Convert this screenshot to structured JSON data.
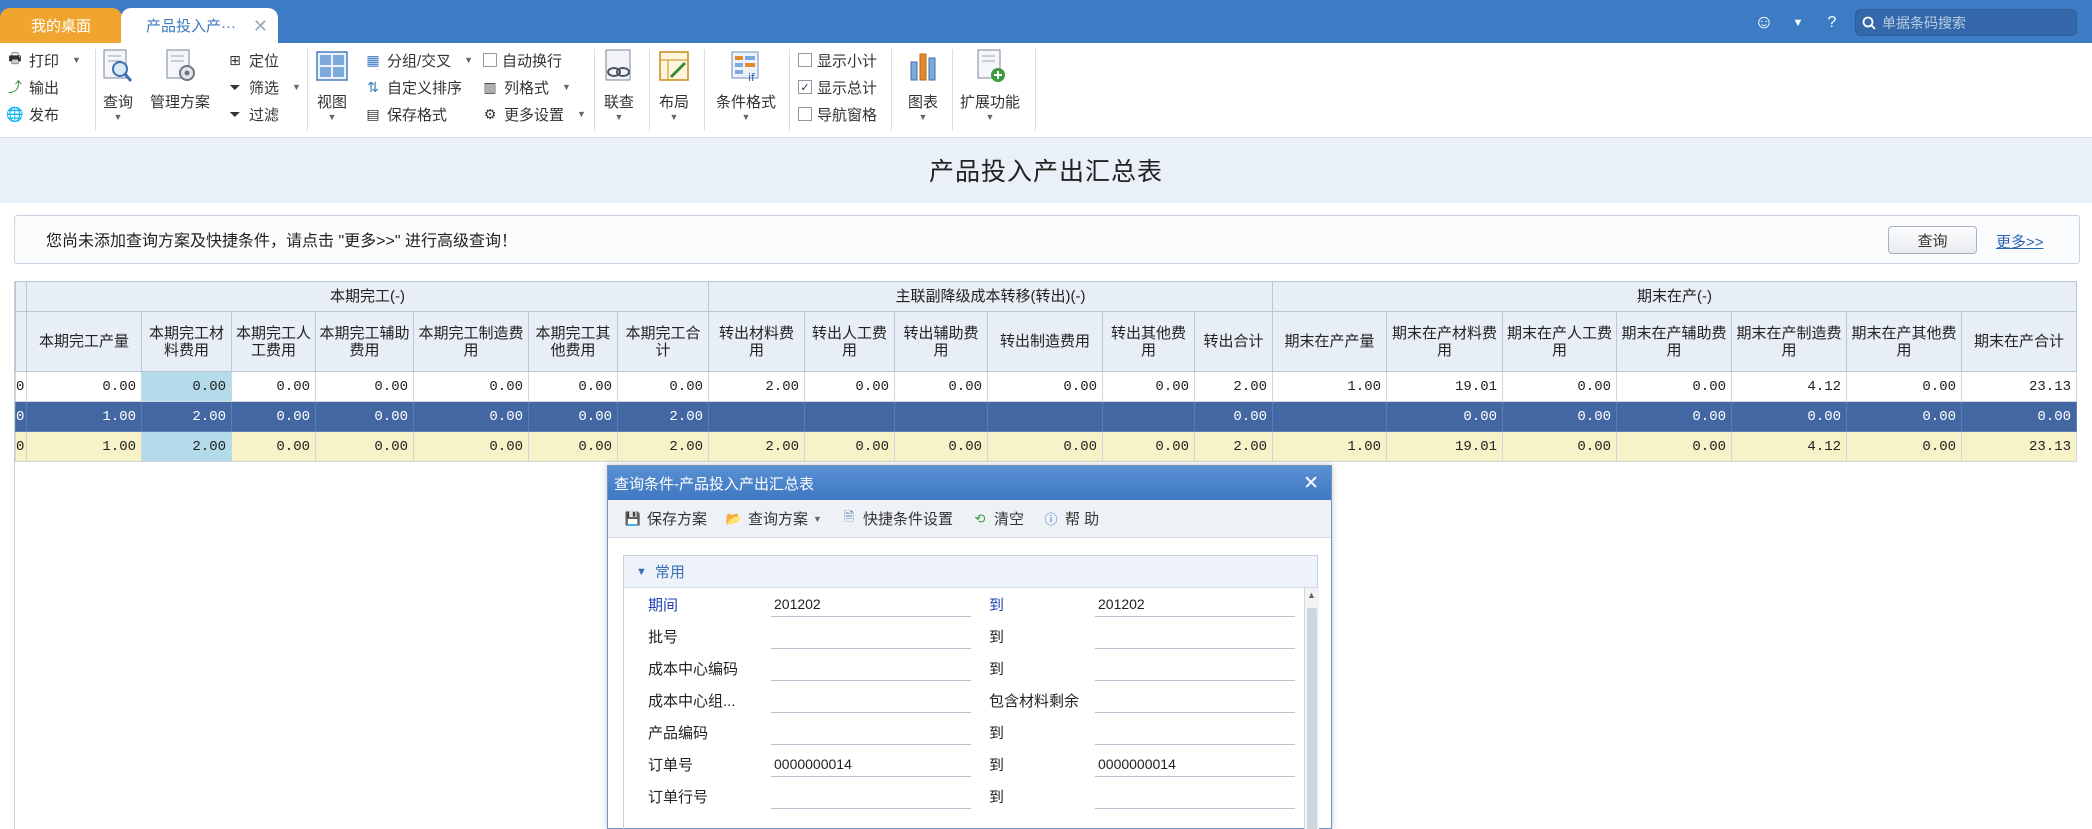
{
  "tabs": {
    "home": "我的桌面",
    "report": "产品投入产···"
  },
  "search": {
    "placeholder": "单据条码搜索"
  },
  "toolbar": {
    "print": "打印",
    "export": "输出",
    "publish": "发布",
    "query": "查询",
    "manage_plan": "管理方案",
    "locate": "定位",
    "filter": "筛选",
    "filter2": "过滤",
    "view": "视图",
    "group_cross": "分组/交叉",
    "custom_sort": "自定义排序",
    "save_format": "保存格式",
    "auto_wrap": "自动换行",
    "column_format": "列格式",
    "more_settings": "更多设置",
    "link_query": "联查",
    "layout": "布局",
    "cond_format": "条件格式",
    "show_subtotal": "显示小计",
    "show_total": "显示总计",
    "nav_pane": "导航窗格",
    "chart": "图表",
    "extend": "扩展功能"
  },
  "page_title": "产品投入产出汇总表",
  "notice": {
    "text": "您尚未添加查询方案及快捷条件，请点击 \"更多>>\" 进行高级查询！",
    "query_button": "查询",
    "more_link": "更多>>"
  },
  "grid": {
    "groups": [
      "本期完工(-)",
      "主联副降级成本转移(转出)(-)",
      "期末在产(-)"
    ],
    "headers": [
      "本期完工产量",
      "本期完工材料费用",
      "本期完工人工费用",
      "本期完工辅助费用",
      "本期完工制造费用",
      "本期完工其他费用",
      "本期完工合计",
      "转出材料费用",
      "转出人工费用",
      "转出辅助费用",
      "转出制造费用",
      "转出其他费用",
      "转出合计",
      "期末在产产量",
      "期末在产材料费用",
      "期末在产人工费用",
      "期末在产辅助费用",
      "期末在产制造费用",
      "期末在产其他费用",
      "期末在产合计"
    ],
    "rows": [
      [
        "0",
        "0.00",
        "0.00",
        "0.00",
        "0.00",
        "0.00",
        "0.00",
        "0.00",
        "2.00",
        "0.00",
        "0.00",
        "0.00",
        "0.00",
        "2.00",
        "1.00",
        "19.01",
        "0.00",
        "0.00",
        "4.12",
        "0.00",
        "23.13"
      ],
      [
        "0",
        "1.00",
        "2.00",
        "0.00",
        "0.00",
        "0.00",
        "0.00",
        "2.00",
        "",
        "",
        "",
        "",
        "",
        "0.00",
        "",
        "0.00",
        "0.00",
        "0.00",
        "0.00",
        "0.00",
        "0.00"
      ],
      [
        "0",
        "1.00",
        "2.00",
        "0.00",
        "0.00",
        "0.00",
        "0.00",
        "2.00",
        "2.00",
        "0.00",
        "0.00",
        "0.00",
        "0.00",
        "2.00",
        "1.00",
        "19.01",
        "0.00",
        "0.00",
        "4.12",
        "0.00",
        "23.13"
      ]
    ]
  },
  "dialog": {
    "title": "查询条件-产品投入产出汇总表",
    "tools": [
      "保存方案",
      "查询方案",
      "快捷条件设置",
      "清空",
      "帮 助"
    ],
    "section": "常用",
    "to_label": "到",
    "fields": [
      {
        "label": "期间",
        "from": "201202",
        "to_label": "到",
        "to": "201202",
        "blue": true
      },
      {
        "label": "批号",
        "from": "",
        "to_label": "到",
        "to": ""
      },
      {
        "label": "成本中心编码",
        "from": "",
        "to_label": "到",
        "to": ""
      },
      {
        "label": "成本中心组...",
        "from": "",
        "to_label": "包含材料剩余",
        "to": ""
      },
      {
        "label": "产品编码",
        "from": "",
        "to_label": "到",
        "to": ""
      },
      {
        "label": "订单号",
        "from": "0000000014",
        "to_label": "到",
        "to": "0000000014"
      },
      {
        "label": "订单行号",
        "from": "",
        "to_label": "到",
        "to": ""
      }
    ]
  },
  "colors": {
    "topbar": "#3d7bc4",
    "home_tab": "#f0a52e",
    "selected_row": "#4367a3",
    "total_row": "#f7f2c8"
  }
}
